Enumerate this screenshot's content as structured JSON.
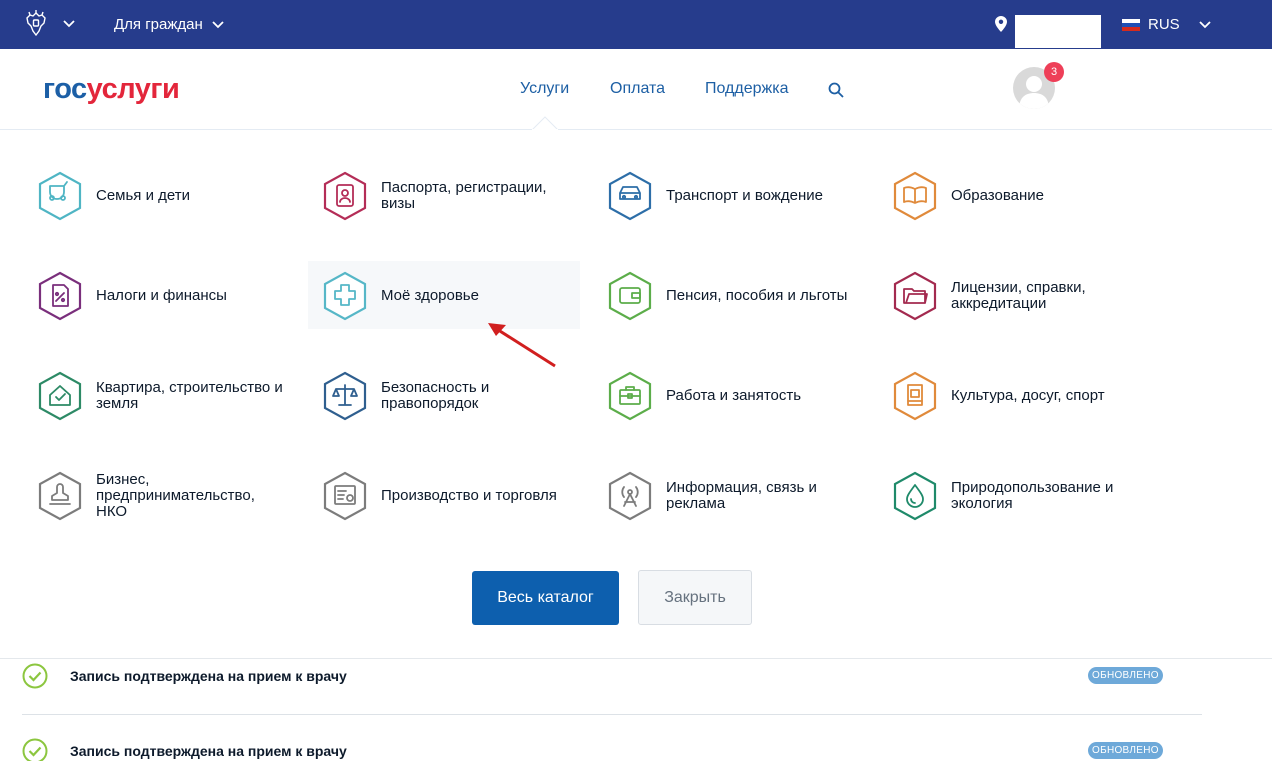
{
  "topbar": {
    "for_citizens": "Для граждан",
    "language": "RUS",
    "location_value": ""
  },
  "header": {
    "logo_part1": "гос",
    "logo_part2": "услуги",
    "nav": [
      "Услуги",
      "Оплата",
      "Поддержка"
    ],
    "notifications_count": "3"
  },
  "catalog": [
    {
      "label": "Семья и дети",
      "icon": "stroller-icon",
      "color": "#4fb5c4"
    },
    {
      "label": "Паспорта, регистрации, визы",
      "icon": "passport-icon",
      "color": "#b42d57"
    },
    {
      "label": "Транспорт и вождение",
      "icon": "car-icon",
      "color": "#2d6ea8"
    },
    {
      "label": "Образование",
      "icon": "book-icon",
      "color": "#e08a3b"
    },
    {
      "label": "Налоги и финансы",
      "icon": "tax-document-icon",
      "color": "#7a2f7c"
    },
    {
      "label": "Моё здоровье",
      "icon": "medical-cross-icon",
      "color": "#56b7c7"
    },
    {
      "label": "Пенсия, пособия и льготы",
      "icon": "wallet-icon",
      "color": "#5cad4a"
    },
    {
      "label": "Лицензии, справки, аккредитации",
      "icon": "folder-icon",
      "color": "#a32a4f"
    },
    {
      "label": "Квартира, строительство и земля",
      "icon": "house-icon",
      "color": "#2d8a66"
    },
    {
      "label": "Безопасность и правопорядок",
      "icon": "scales-icon",
      "color": "#2f5f8f"
    },
    {
      "label": "Работа и занятость",
      "icon": "briefcase-icon",
      "color": "#5cad4a"
    },
    {
      "label": "Культура, досуг, спорт",
      "icon": "culture-icon",
      "color": "#e08a3b"
    },
    {
      "label": "Бизнес, предпринимательство, НКО",
      "icon": "stamp-icon",
      "color": "#7c7c7c"
    },
    {
      "label": "Производство и торговля",
      "icon": "certificate-icon",
      "color": "#7c7c7c"
    },
    {
      "label": "Информация, связь и реклама",
      "icon": "antenna-icon",
      "color": "#7c7c7c"
    },
    {
      "label": "Природопользование и экология",
      "icon": "water-drop-icon",
      "color": "#1f8a6a"
    }
  ],
  "buttons": {
    "catalog": "Весь каталог",
    "close": "Закрыть"
  },
  "notifications": [
    {
      "text": "Запись подтверждена на прием к врачу",
      "status": "ОБНОВЛЕНО"
    },
    {
      "text": "Запись подтверждена на прием к врачу",
      "status": "ОБНОВЛЕНО"
    }
  ],
  "colors": {
    "topbar": "#263c8c",
    "primary": "#0d5fae",
    "nav_link": "#1d5fa4",
    "logo_red": "#e3263b",
    "check_green": "#8cc63f",
    "arrow_red": "#d11f1f"
  }
}
